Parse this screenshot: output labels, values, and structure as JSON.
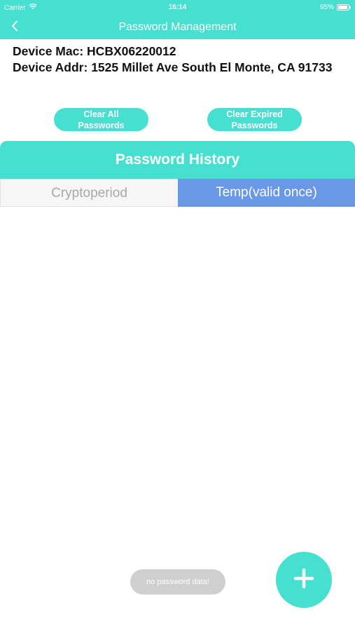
{
  "status_bar": {
    "carrier": "Carrier",
    "time": "16:14",
    "battery": "95%",
    "wifi_icon": "wifi-icon",
    "battery_icon": "battery-icon"
  },
  "nav": {
    "title": "Password Management",
    "back_icon": "chevron-left-icon"
  },
  "device": {
    "mac_label": "Device Mac:",
    "mac_value": "HCBX06220012",
    "addr_label": "Device Addr:",
    "addr_value": "1525 Millet Ave South El Monte, CA 91733"
  },
  "actions": {
    "clear_all_line1": "Clear All",
    "clear_all_line2": "Passwords",
    "clear_expired_line1": "Clear Expired",
    "clear_expired_line2": "Passwords"
  },
  "history": {
    "title": "Password History",
    "tabs": [
      {
        "label": "Cryptoperiod",
        "selected": false
      },
      {
        "label": "Temp(valid once)",
        "selected": true
      }
    ]
  },
  "toast": {
    "message": "no password data!"
  },
  "fab": {
    "icon": "plus-icon"
  },
  "colors": {
    "primary": "#46e0d0",
    "tab_selected": "#6a97e8",
    "tab_unselected_bg": "#f6f6f6",
    "tab_unselected_text": "#a8a8a8",
    "toast_bg": "#cfcfcf"
  }
}
